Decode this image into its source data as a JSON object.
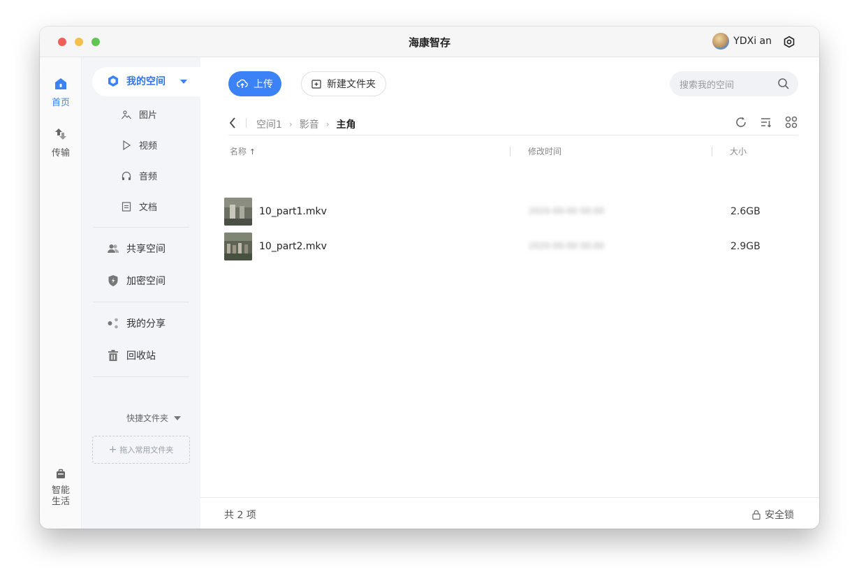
{
  "window": {
    "title": "海康智存",
    "user": {
      "name": "YDXi an"
    }
  },
  "rail": {
    "home_label": "首页",
    "transfer_label": "传输",
    "life_label_1": "智能",
    "life_label_2": "生活"
  },
  "sidebar": {
    "my_space": "我的空间",
    "sub_items": [
      "图片",
      "视频",
      "音频",
      "文档"
    ],
    "shared_space": "共享空间",
    "encrypted_space": "加密空间",
    "my_share": "我的分享",
    "recycle_bin": "回收站",
    "quick_folders": "快捷文件夹",
    "drop_hint": "拖入常用文件夹"
  },
  "toolbar": {
    "upload_label": "上传",
    "new_folder_label": "新建文件夹",
    "search_placeholder": "搜索我的空间"
  },
  "breadcrumb": [
    "空间1",
    "影音",
    "主角"
  ],
  "table": {
    "columns": {
      "name": "名称",
      "modified": "修改时间",
      "size": "大小"
    },
    "rows": [
      {
        "name": "10_part1.mkv",
        "modified": "2020-00-00 00:00",
        "size": "2.6GB"
      },
      {
        "name": "10_part2.mkv",
        "modified": "2020-00-00 00:00",
        "size": "2.9GB"
      }
    ]
  },
  "footer": {
    "count_label": "共 2 项",
    "lock_label": "安全锁"
  },
  "colors": {
    "accent": "#3b82f6",
    "sidebar_bg": "#f3f5f8"
  }
}
